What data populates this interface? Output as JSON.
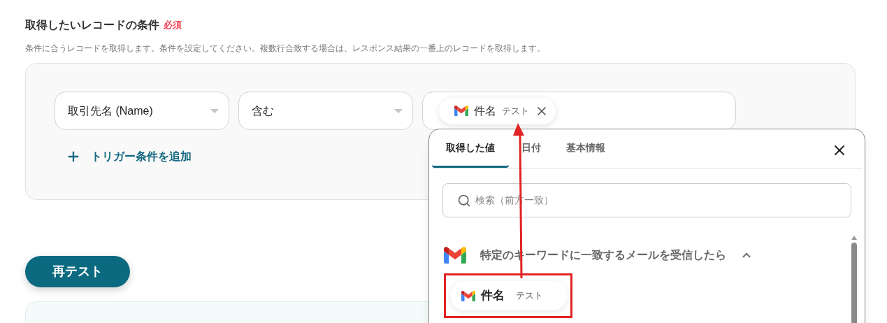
{
  "section": {
    "title": "取得したいレコードの条件",
    "required": "必須",
    "description": "条件に合うレコードを取得します。条件を設定してください。複数行合致する場合は、レスポンス結果の一番上のレコードを取得します。"
  },
  "conditions": [
    {
      "kind": "select",
      "value": "取引先名 (Name)"
    },
    {
      "kind": "select",
      "value": "含む"
    },
    {
      "kind": "tokens",
      "tokens": [
        {
          "label": "件名",
          "value": "テスト"
        }
      ]
    }
  ],
  "add_condition": "トリガー条件を追加",
  "retest_button": "再テスト",
  "popup": {
    "tabs": [
      {
        "label": "取得した値",
        "selected": true
      },
      {
        "label": "日付",
        "selected": false
      },
      {
        "label": "基本情報",
        "selected": false
      }
    ],
    "search": {
      "placeholder": "検索（前方一致）"
    },
    "group": {
      "title": "特定のキーワードに一致するメールを受信したら",
      "expanded": true
    },
    "items": [
      {
        "label": "件名",
        "value": "テスト",
        "highlighted": true
      }
    ]
  }
}
